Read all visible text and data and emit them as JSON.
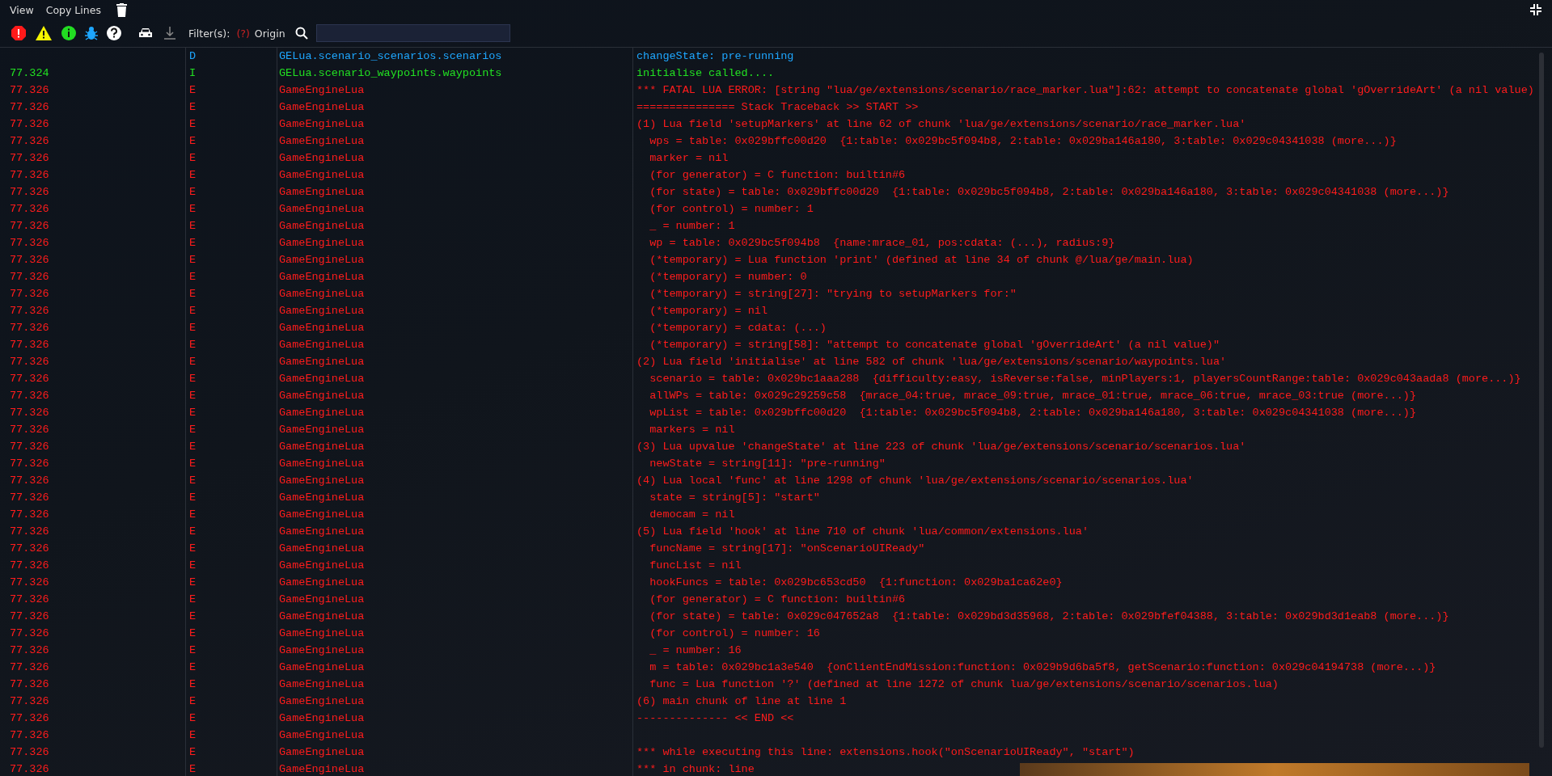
{
  "menu": [
    "View",
    "Copy Lines"
  ],
  "filters": {
    "label": "Filter(s):",
    "unknown": "(?)",
    "origin": "Origin"
  },
  "rows": [
    {
      "level": "D",
      "kind": "debug",
      "origin": "GELua.scenario_scenarios.scenarios",
      "message": "changeState: pre-running"
    },
    {
      "time": "77.324",
      "level": "I",
      "kind": "info",
      "origin": "GELua.scenario_waypoints.waypoints",
      "message": "initialise called...."
    },
    {
      "time": "77.326",
      "level": "E",
      "kind": "error",
      "origin": "GameEngineLua",
      "message": "*** FATAL LUA ERROR: [string \"lua/ge/extensions/scenario/race_marker.lua\"]:62: attempt to concatenate global 'gOverrideArt' (a nil value)"
    },
    {
      "time": "77.326",
      "level": "E",
      "kind": "error",
      "origin": "GameEngineLua",
      "message": "=============== Stack Traceback >> START >>"
    },
    {
      "time": "77.326",
      "level": "E",
      "kind": "error",
      "origin": "GameEngineLua",
      "message": "(1) Lua field 'setupMarkers' at line 62 of chunk 'lua/ge/extensions/scenario/race_marker.lua'"
    },
    {
      "time": "77.326",
      "level": "E",
      "kind": "error",
      "origin": "GameEngineLua",
      "message": "  wps = table: 0x029bffc00d20  {1:table: 0x029bc5f094b8, 2:table: 0x029ba146a180, 3:table: 0x029c04341038 (more...)}"
    },
    {
      "time": "77.326",
      "level": "E",
      "kind": "error",
      "origin": "GameEngineLua",
      "message": "  marker = nil"
    },
    {
      "time": "77.326",
      "level": "E",
      "kind": "error",
      "origin": "GameEngineLua",
      "message": "  (for generator) = C function: builtin#6"
    },
    {
      "time": "77.326",
      "level": "E",
      "kind": "error",
      "origin": "GameEngineLua",
      "message": "  (for state) = table: 0x029bffc00d20  {1:table: 0x029bc5f094b8, 2:table: 0x029ba146a180, 3:table: 0x029c04341038 (more...)}"
    },
    {
      "time": "77.326",
      "level": "E",
      "kind": "error",
      "origin": "GameEngineLua",
      "message": "  (for control) = number: 1"
    },
    {
      "time": "77.326",
      "level": "E",
      "kind": "error",
      "origin": "GameEngineLua",
      "message": "  _ = number: 1"
    },
    {
      "time": "77.326",
      "level": "E",
      "kind": "error",
      "origin": "GameEngineLua",
      "message": "  wp = table: 0x029bc5f094b8  {name:mrace_01, pos:cdata: (...), radius:9}"
    },
    {
      "time": "77.326",
      "level": "E",
      "kind": "error",
      "origin": "GameEngineLua",
      "message": "  (*temporary) = Lua function 'print' (defined at line 34 of chunk @/lua/ge/main.lua)"
    },
    {
      "time": "77.326",
      "level": "E",
      "kind": "error",
      "origin": "GameEngineLua",
      "message": "  (*temporary) = number: 0"
    },
    {
      "time": "77.326",
      "level": "E",
      "kind": "error",
      "origin": "GameEngineLua",
      "message": "  (*temporary) = string[27]: \"trying to setupMarkers for:\""
    },
    {
      "time": "77.326",
      "level": "E",
      "kind": "error",
      "origin": "GameEngineLua",
      "message": "  (*temporary) = nil"
    },
    {
      "time": "77.326",
      "level": "E",
      "kind": "error",
      "origin": "GameEngineLua",
      "message": "  (*temporary) = cdata: (...)"
    },
    {
      "time": "77.326",
      "level": "E",
      "kind": "error",
      "origin": "GameEngineLua",
      "message": "  (*temporary) = string[58]: \"attempt to concatenate global 'gOverrideArt' (a nil value)\""
    },
    {
      "time": "77.326",
      "level": "E",
      "kind": "error",
      "origin": "GameEngineLua",
      "message": "(2) Lua field 'initialise' at line 582 of chunk 'lua/ge/extensions/scenario/waypoints.lua'"
    },
    {
      "time": "77.326",
      "level": "E",
      "kind": "error",
      "origin": "GameEngineLua",
      "message": "  scenario = table: 0x029bc1aaa288  {difficulty:easy, isReverse:false, minPlayers:1, playersCountRange:table: 0x029c043aada8 (more...)}"
    },
    {
      "time": "77.326",
      "level": "E",
      "kind": "error",
      "origin": "GameEngineLua",
      "message": "  allWPs = table: 0x029c29259c58  {mrace_04:true, mrace_09:true, mrace_01:true, mrace_06:true, mrace_03:true (more...)}"
    },
    {
      "time": "77.326",
      "level": "E",
      "kind": "error",
      "origin": "GameEngineLua",
      "message": "  wpList = table: 0x029bffc00d20  {1:table: 0x029bc5f094b8, 2:table: 0x029ba146a180, 3:table: 0x029c04341038 (more...)}"
    },
    {
      "time": "77.326",
      "level": "E",
      "kind": "error",
      "origin": "GameEngineLua",
      "message": "  markers = nil"
    },
    {
      "time": "77.326",
      "level": "E",
      "kind": "error",
      "origin": "GameEngineLua",
      "message": "(3) Lua upvalue 'changeState' at line 223 of chunk 'lua/ge/extensions/scenario/scenarios.lua'"
    },
    {
      "time": "77.326",
      "level": "E",
      "kind": "error",
      "origin": "GameEngineLua",
      "message": "  newState = string[11]: \"pre-running\""
    },
    {
      "time": "77.326",
      "level": "E",
      "kind": "error",
      "origin": "GameEngineLua",
      "message": "(4) Lua local 'func' at line 1298 of chunk 'lua/ge/extensions/scenario/scenarios.lua'"
    },
    {
      "time": "77.326",
      "level": "E",
      "kind": "error",
      "origin": "GameEngineLua",
      "message": "  state = string[5]: \"start\""
    },
    {
      "time": "77.326",
      "level": "E",
      "kind": "error",
      "origin": "GameEngineLua",
      "message": "  democam = nil"
    },
    {
      "time": "77.326",
      "level": "E",
      "kind": "error",
      "origin": "GameEngineLua",
      "message": "(5) Lua field 'hook' at line 710 of chunk 'lua/common/extensions.lua'"
    },
    {
      "time": "77.326",
      "level": "E",
      "kind": "error",
      "origin": "GameEngineLua",
      "message": "  funcName = string[17]: \"onScenarioUIReady\""
    },
    {
      "time": "77.326",
      "level": "E",
      "kind": "error",
      "origin": "GameEngineLua",
      "message": "  funcList = nil"
    },
    {
      "time": "77.326",
      "level": "E",
      "kind": "error",
      "origin": "GameEngineLua",
      "message": "  hookFuncs = table: 0x029bc653cd50  {1:function: 0x029ba1ca62e0}"
    },
    {
      "time": "77.326",
      "level": "E",
      "kind": "error",
      "origin": "GameEngineLua",
      "message": "  (for generator) = C function: builtin#6"
    },
    {
      "time": "77.326",
      "level": "E",
      "kind": "error",
      "origin": "GameEngineLua",
      "message": "  (for state) = table: 0x029c047652a8  {1:table: 0x029bd3d35968, 2:table: 0x029bfef04388, 3:table: 0x029bd3d1eab8 (more...)}"
    },
    {
      "time": "77.326",
      "level": "E",
      "kind": "error",
      "origin": "GameEngineLua",
      "message": "  (for control) = number: 16"
    },
    {
      "time": "77.326",
      "level": "E",
      "kind": "error",
      "origin": "GameEngineLua",
      "message": "  _ = number: 16"
    },
    {
      "time": "77.326",
      "level": "E",
      "kind": "error",
      "origin": "GameEngineLua",
      "message": "  m = table: 0x029bc1a3e540  {onClientEndMission:function: 0x029b9d6ba5f8, getScenario:function: 0x029c04194738 (more...)}"
    },
    {
      "time": "77.326",
      "level": "E",
      "kind": "error",
      "origin": "GameEngineLua",
      "message": "  func = Lua function '?' (defined at line 1272 of chunk lua/ge/extensions/scenario/scenarios.lua)"
    },
    {
      "time": "77.326",
      "level": "E",
      "kind": "error",
      "origin": "GameEngineLua",
      "message": "(6) main chunk of line at line 1"
    },
    {
      "time": "77.326",
      "level": "E",
      "kind": "error",
      "origin": "GameEngineLua",
      "message": "-------------- << END <<"
    },
    {
      "time": "77.326",
      "level": "E",
      "kind": "error",
      "origin": "GameEngineLua"
    },
    {
      "time": "77.326",
      "level": "E",
      "kind": "error",
      "origin": "GameEngineLua",
      "message": "*** while executing this line: extensions.hook(\"onScenarioUIReady\", \"start\")"
    },
    {
      "time": "77.326",
      "level": "E",
      "kind": "error",
      "origin": "GameEngineLua",
      "message": "*** in chunk: line"
    }
  ]
}
